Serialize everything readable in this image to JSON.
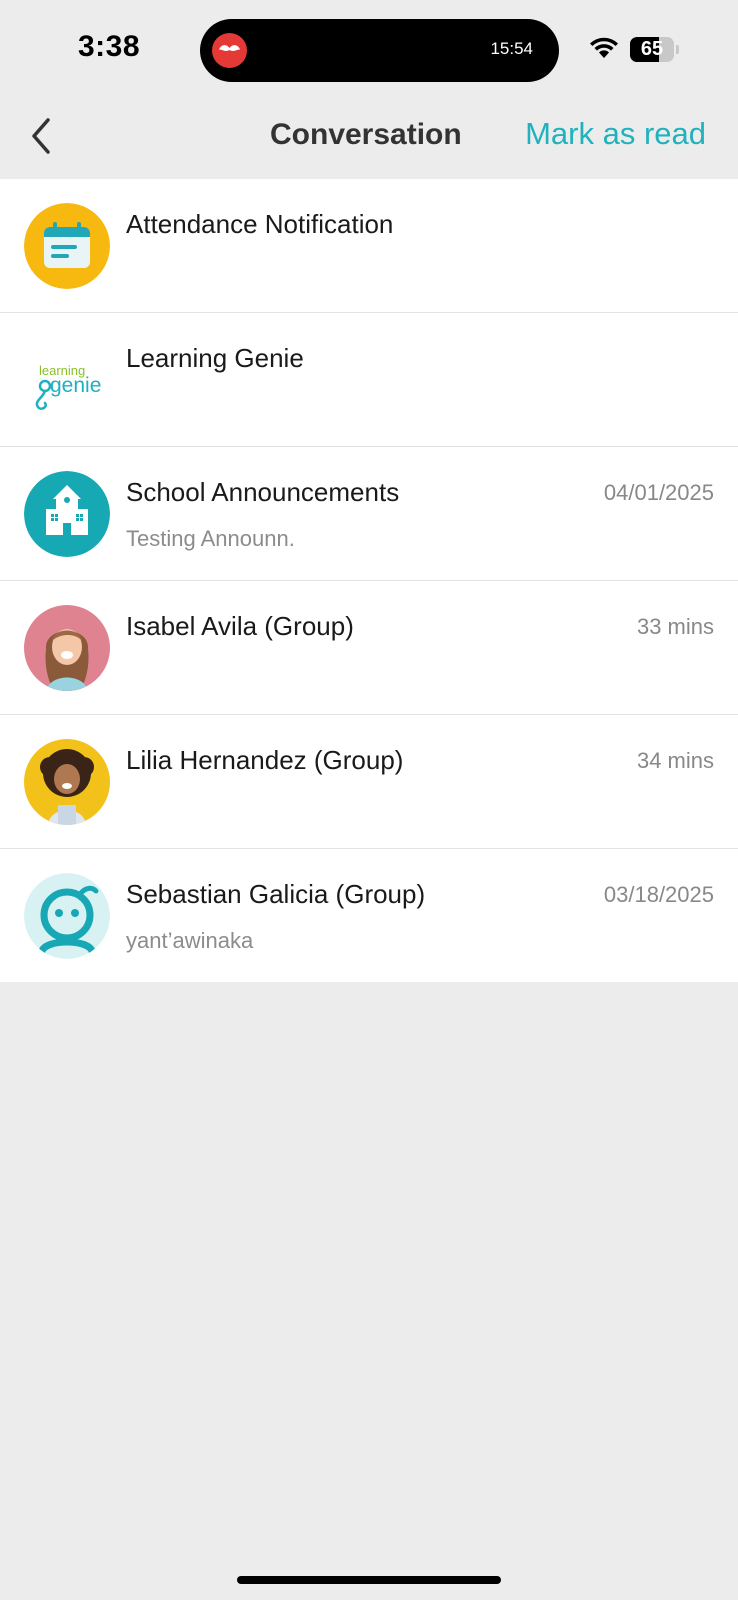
{
  "status_bar": {
    "time": "3:38",
    "island_time": "15:54",
    "battery_level": "65",
    "battery_fraction": 0.65,
    "island_app_icon": "mustache-app-icon",
    "wifi_icon": "wifi-icon"
  },
  "nav": {
    "back_icon": "chevron-left-icon",
    "title": "Conversation",
    "action_label": "Mark as read"
  },
  "conversations": [
    {
      "name": "Attendance Notification",
      "preview": "",
      "time": "",
      "avatar": "calendar-icon"
    },
    {
      "name": "Learning Genie",
      "preview": "",
      "time": "",
      "avatar": "learning-genie-logo",
      "logo_text_top": "learning",
      "logo_text_bottom": "genie"
    },
    {
      "name": "School Announcements",
      "preview": "Testing Announn.",
      "time": "04/01/2025",
      "avatar": "school-house-icon"
    },
    {
      "name": "Isabel Avila (Group)",
      "preview": "",
      "time": "33 mins",
      "avatar": "child-photo-avatar"
    },
    {
      "name": "Lilia Hernandez (Group)",
      "preview": "",
      "time": "34 mins",
      "avatar": "child-photo-avatar"
    },
    {
      "name": "Sebastian Galicia (Group)",
      "preview": "yant’awinaka",
      "time": "03/18/2025",
      "avatar": "genie-character-avatar"
    }
  ],
  "colors": {
    "accent": "#20b2bd",
    "background": "#ececec",
    "calendar_bg": "#f7b80f",
    "school_bg": "#16a9b4",
    "genie_bg": "#d8f2f3",
    "isabel_bg": "#e08391",
    "lilia_bg": "#f3c21a"
  }
}
